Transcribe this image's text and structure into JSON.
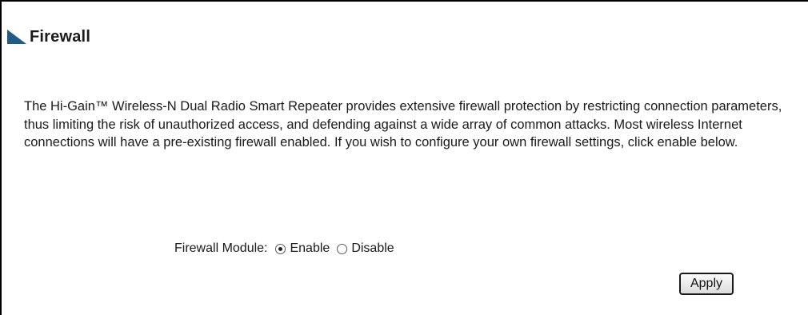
{
  "page": {
    "title": "Firewall",
    "description": "The Hi-Gain™ Wireless-N Dual Radio Smart Repeater provides extensive firewall protection by restricting connection parameters, thus limiting the risk of unauthorized access, and defending against a wide array of common attacks. Most wireless Internet connections will have a pre-existing firewall enabled. If you wish to configure your own firewall settings, click enable below."
  },
  "firewall_module": {
    "label": "Firewall Module:",
    "options": [
      {
        "label": "Enable",
        "selected": true
      },
      {
        "label": "Disable",
        "selected": false
      }
    ]
  },
  "actions": {
    "apply_label": "Apply"
  },
  "colors": {
    "accent": "#1f5d86",
    "text": "#1a1a1a"
  },
  "icons": {
    "title_marker": "triangle-marker-icon"
  }
}
